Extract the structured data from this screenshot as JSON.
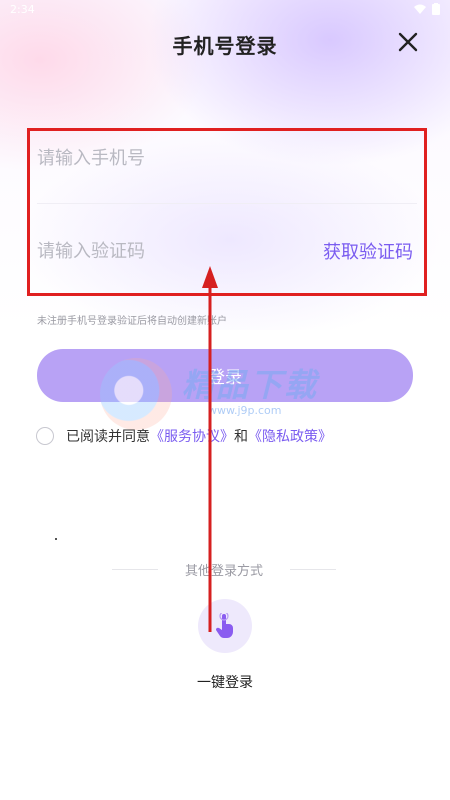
{
  "status_bar": {
    "time": "2:34"
  },
  "header": {
    "title": "手机号登录"
  },
  "form": {
    "phone_placeholder": "请输入手机号",
    "code_placeholder": "请输入验证码",
    "get_code_label": "获取验证码",
    "hint": "未注册手机号登录验证后将自动创建新账户",
    "login_label": "登录"
  },
  "agreement": {
    "prefix": "已阅读并同意",
    "service_link": "《服务协议》",
    "and": "和",
    "privacy_link": "《隐私政策》"
  },
  "other_login": {
    "label": "其他登录方式",
    "one_key_label": "一键登录",
    "icon": "tap-finger-icon"
  },
  "watermark": {
    "text": "精品下载",
    "url": "www.j9p.com"
  },
  "colors": {
    "accent": "#7a5cf0",
    "button_bg": "#b8a2f5",
    "highlight_box": "#e02020"
  }
}
